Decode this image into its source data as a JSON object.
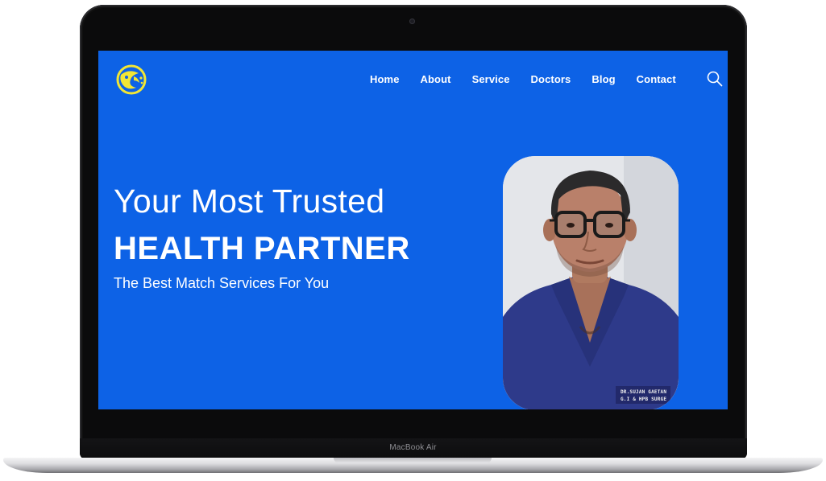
{
  "device": {
    "label": "MacBook Air"
  },
  "site": {
    "logo_icon": "health-logo-icon",
    "accent_color": "#0d62e6",
    "logo_color": "#f2e635"
  },
  "nav": {
    "items": [
      {
        "label": "Home"
      },
      {
        "label": "About"
      },
      {
        "label": "Service"
      },
      {
        "label": "Doctors"
      },
      {
        "label": "Blog"
      },
      {
        "label": "Contact"
      }
    ],
    "search_icon": "search-icon"
  },
  "hero": {
    "line1": "Your Most Trusted",
    "line2": "HEALTH PARTNER",
    "subtitle": "The Best Match Services For You"
  },
  "doctor": {
    "badge_line1": "DR.SUJAN GAETAN",
    "badge_line2": "G.I & HPB SURGE"
  }
}
